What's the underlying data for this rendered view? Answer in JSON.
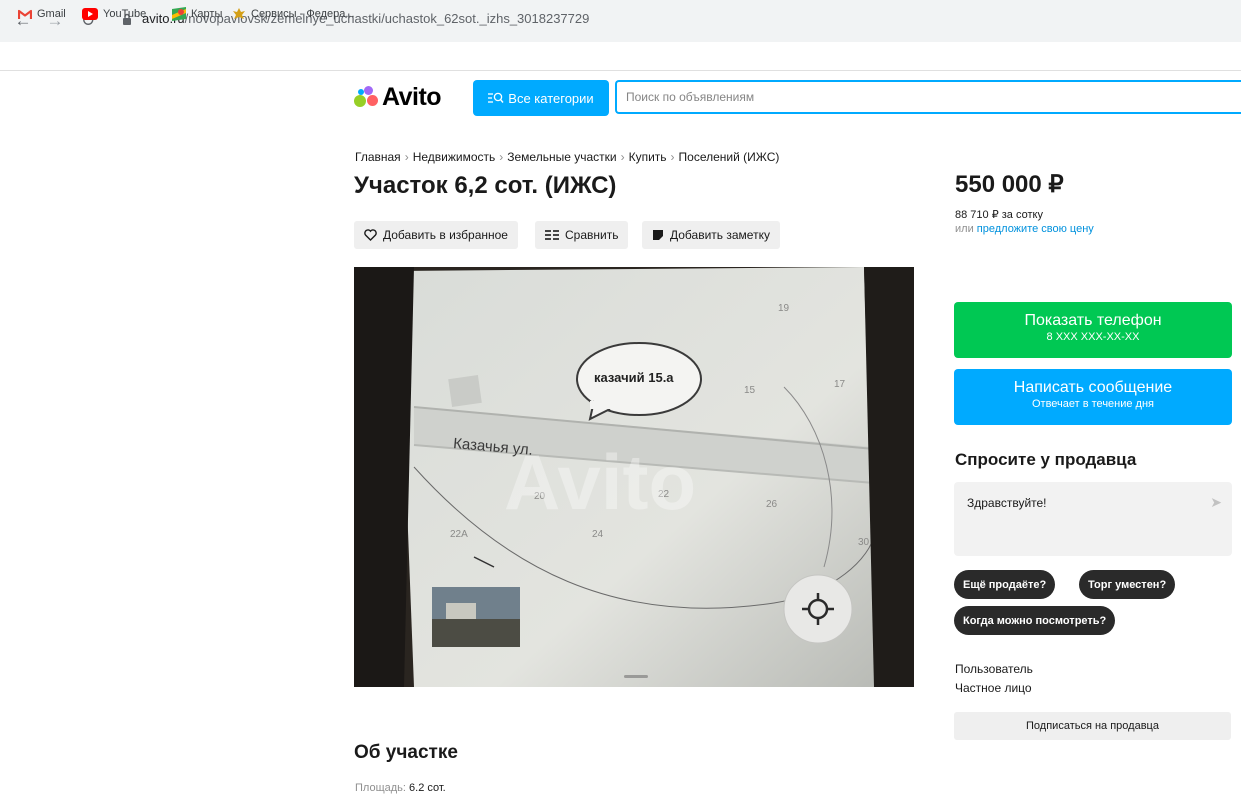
{
  "browser": {
    "url_host": "avito.ru",
    "url_path": "/novopavlovsk/zemelnye_uchastki/uchastok_62sot._izhs_3018237729",
    "bookmarks": [
      {
        "label": "Gmail",
        "icon": "gmail-icon",
        "color": "#ea4335"
      },
      {
        "label": "YouTube",
        "icon": "youtube-icon",
        "color": "#ff0000"
      },
      {
        "label": "Карты",
        "icon": "maps-icon",
        "color": "#34a853"
      },
      {
        "label": "Сервисы - Федера...",
        "icon": "emblem-icon",
        "color": "#d4a017"
      }
    ]
  },
  "header": {
    "logo_text": "Avito",
    "categories_label": "Все категории",
    "search_placeholder": "Поиск по объявлениям",
    "accent_color": "#00aaff"
  },
  "breadcrumb": [
    "Главная",
    "Недвижимость",
    "Земельные участки",
    "Купить",
    "Поселений (ИЖС)"
  ],
  "listing": {
    "title": "Участок 6,2 сот. (ИЖС)",
    "price": "550 000 ₽",
    "price_per": "88 710 ₽ за сотку",
    "offer_prefix": "или",
    "offer_link": "предложите свою цену"
  },
  "actions": {
    "favorite": "Добавить в избранное",
    "compare": "Сравнить",
    "note": "Добавить заметку"
  },
  "gallery": {
    "bubble_text": "казачий 15.а",
    "street_label": "Казачья ул.",
    "numbers": [
      "19",
      "15",
      "17",
      "20",
      "22",
      "26",
      "24",
      "22А",
      "30"
    ],
    "watermark": "Avito"
  },
  "contact": {
    "phone_title": "Показать телефон",
    "phone_masked": "8 XXX XXX-XX-XX",
    "message_title": "Написать сообщение",
    "message_sub": "Отвечает в течение дня",
    "phone_color": "#00c853"
  },
  "ask": {
    "heading": "Спросите у продавца",
    "text": "Здравствуйте!",
    "chips": [
      "Ещё продаёте?",
      "Торг уместен?",
      "Когда можно посмотреть?"
    ]
  },
  "seller": {
    "name": "Пользователь",
    "type": "Частное лицо",
    "subscribe": "Подписаться на продавца"
  },
  "about": {
    "heading": "Об участке",
    "area_label": "Площадь:",
    "area_value": "6.2 сот."
  }
}
